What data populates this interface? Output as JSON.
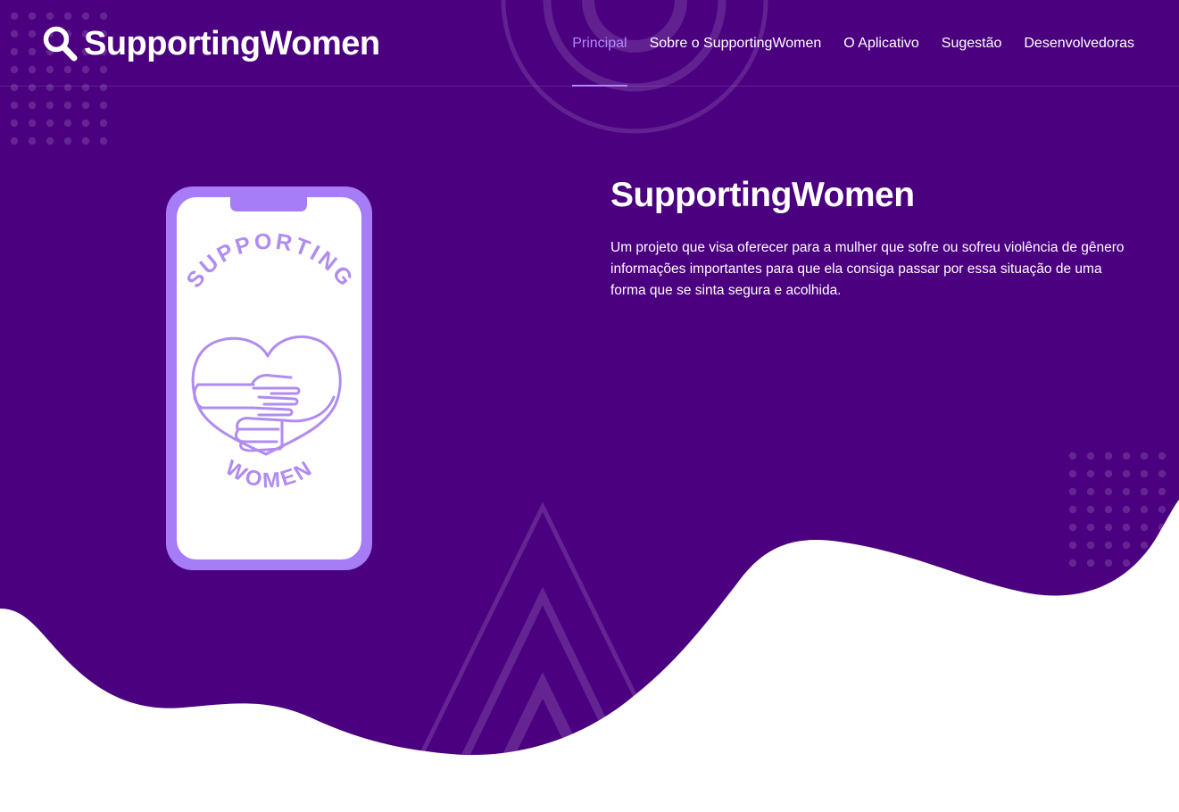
{
  "brand": {
    "name": "SupportingWomen",
    "icon": "search-icon"
  },
  "nav": {
    "items": [
      {
        "label": "Principal",
        "active": true
      },
      {
        "label": "Sobre o SupportingWomen",
        "active": false
      },
      {
        "label": "O Aplicativo",
        "active": false
      },
      {
        "label": "Sugestão",
        "active": false
      },
      {
        "label": "Desenvolvedoras",
        "active": false
      }
    ]
  },
  "hero": {
    "title": "SupportingWomen",
    "description": "Um projeto que visa oferecer para a mulher que sofre ou sofreu violência de gênero informações importantes para que ela consiga passar por essa situação de uma forma que se sinta segura e acolhida.",
    "logo": {
      "top_text": "SUPPORTING",
      "bottom_text": "WOMEN",
      "icon": "heart-hug-icon"
    }
  },
  "colors": {
    "background": "#4b0080",
    "accent": "#b388ff",
    "phone_frame": "#a67cf7",
    "logo": "#b08cf0",
    "wave": "#ffffff"
  }
}
